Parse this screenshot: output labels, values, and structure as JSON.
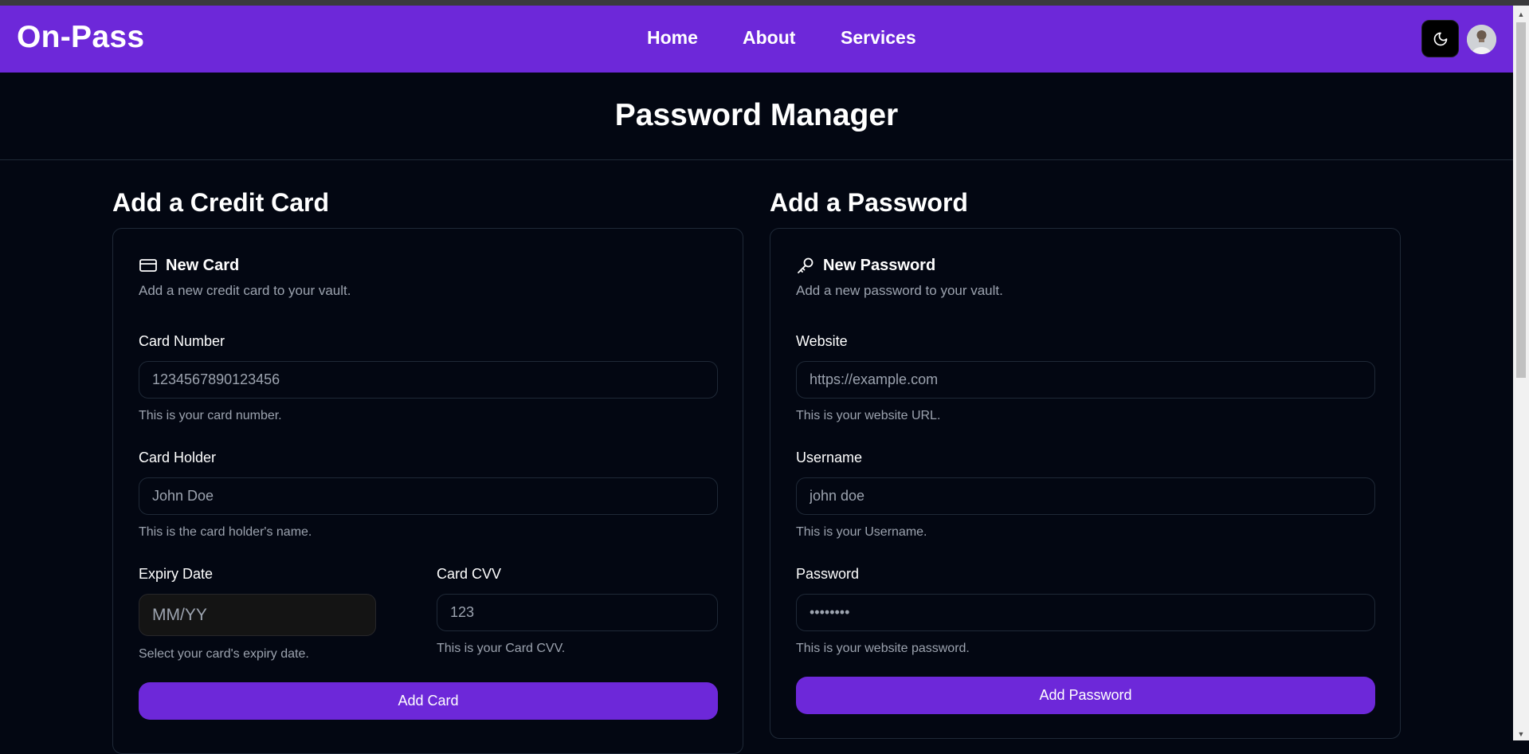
{
  "app": {
    "logo": "On-Pass"
  },
  "nav": {
    "items": [
      {
        "label": "Home"
      },
      {
        "label": "About"
      },
      {
        "label": "Services"
      }
    ],
    "theme_icon": "moon-icon",
    "avatar_icon": "user-avatar"
  },
  "page": {
    "title": "Password Manager"
  },
  "credit_card": {
    "section_title": "Add a Credit Card",
    "card_title": "New Card",
    "card_icon": "credit-card-icon",
    "description": "Add a new credit card to your vault.",
    "number": {
      "label": "Card Number",
      "placeholder": "1234567890123456",
      "hint": "This is your card number."
    },
    "holder": {
      "label": "Card Holder",
      "placeholder": "John Doe",
      "hint": "This is the card holder's name."
    },
    "expiry": {
      "label": "Expiry Date",
      "placeholder": "MM/YY",
      "hint": "Select your card's expiry date."
    },
    "cvv": {
      "label": "Card CVV",
      "placeholder": "123",
      "hint": "This is your Card CVV."
    },
    "submit_label": "Add Card"
  },
  "password": {
    "section_title": "Add a Password",
    "card_title": "New Password",
    "card_icon": "key-icon",
    "description": "Add a new password to your vault.",
    "website": {
      "label": "Website",
      "placeholder": "https://example.com",
      "hint": "This is your website URL."
    },
    "username": {
      "label": "Username",
      "placeholder": "john doe",
      "hint": "This is your Username."
    },
    "password_field": {
      "label": "Password",
      "placeholder": "••••••••",
      "hint": "This is your website password."
    },
    "submit_label": "Add Password"
  },
  "colors": {
    "accent": "#6d28d9",
    "background": "#030712",
    "border": "#1f2937",
    "muted_text": "#9ca3af"
  }
}
